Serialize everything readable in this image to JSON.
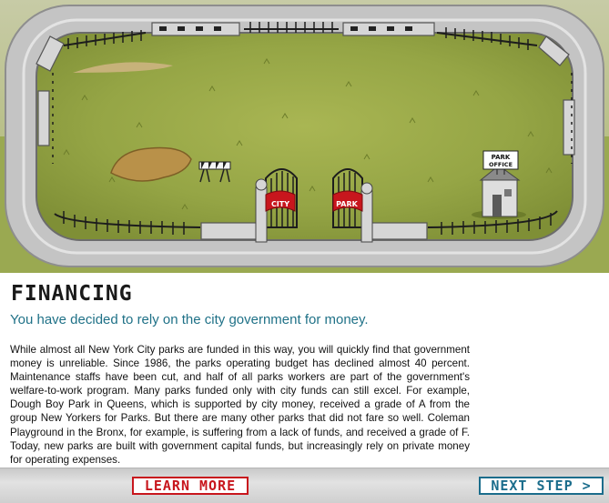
{
  "scene": {
    "gate_left_banner": "CITY",
    "gate_right_banner": "PARK",
    "office_sign": [
      "PARK",
      "OFFICE"
    ]
  },
  "content": {
    "title": "FINANCING",
    "subtitle": "You have decided to rely on the city government for money.",
    "body": "While almost all New York City parks are funded in this way, you will quickly find that government money is unreliable. Since 1986, the parks operating budget has declined almost 40 percent. Maintenance staffs have been cut, and half of all parks workers are part of the government's welfare-to-work program. Many parks funded only with city funds can still excel. For example, Dough Boy Park in Queens, which is supported by city money, received a grade of A from the group New Yorkers for Parks. But there are many other parks that did not fare so well. Coleman Playground in the Bronx, for example, is suffering from a lack of funds, and received a grade of F. Today, new parks are built with government capital funds, but increasingly rely on private money for operating expenses."
  },
  "footer": {
    "learn_more": "LEARN MORE",
    "next_step": "NEXT STEP >"
  },
  "colors": {
    "accent_red": "#c8161d",
    "accent_teal": "#1b6d8c",
    "subtitle_teal": "#1f7187",
    "grass": "#97a848"
  }
}
